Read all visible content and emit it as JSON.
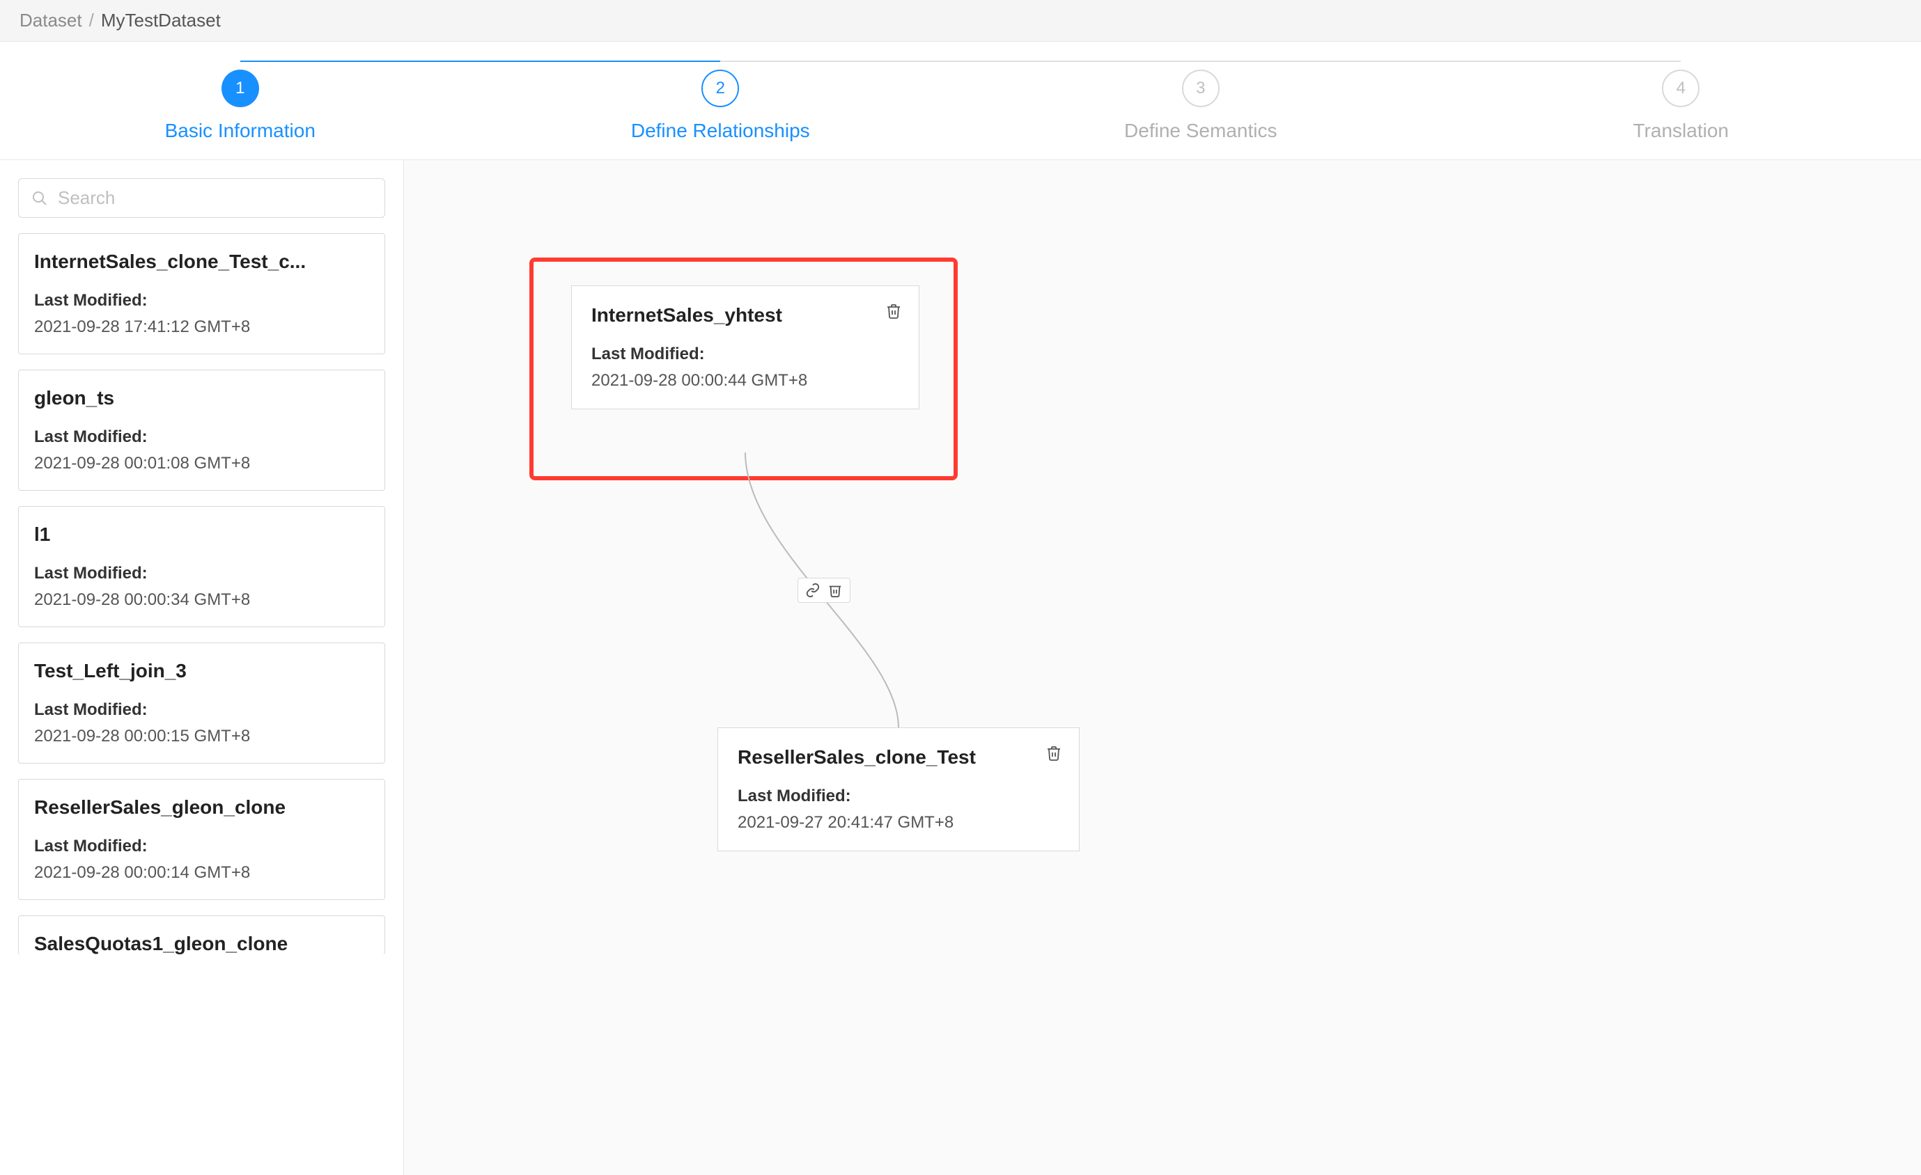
{
  "breadcrumb": {
    "root": "Dataset",
    "current": "MyTestDataset"
  },
  "stepper": {
    "steps": [
      {
        "num": "1",
        "label": "Basic Information",
        "state": "done"
      },
      {
        "num": "2",
        "label": "Define Relationships",
        "state": "current"
      },
      {
        "num": "3",
        "label": "Define Semantics",
        "state": "pending"
      },
      {
        "num": "4",
        "label": "Translation",
        "state": "pending"
      }
    ]
  },
  "sidebar": {
    "search_placeholder": "Search",
    "last_modified_label": "Last Modified:",
    "items": [
      {
        "title": "InternetSales_clone_Test_c...",
        "modified": "2021-09-28 17:41:12 GMT+8"
      },
      {
        "title": "gleon_ts",
        "modified": "2021-09-28 00:01:08 GMT+8"
      },
      {
        "title": "l1",
        "modified": "2021-09-28 00:00:34 GMT+8"
      },
      {
        "title": "Test_Left_join_3",
        "modified": "2021-09-28 00:00:15 GMT+8"
      },
      {
        "title": "ResellerSales_gleon_clone",
        "modified": "2021-09-28 00:00:14 GMT+8"
      },
      {
        "title": "SalesQuotas1_gleon_clone",
        "modified": ""
      }
    ]
  },
  "canvas": {
    "last_modified_label": "Last Modified:",
    "nodes": {
      "top": {
        "title": "InternetSales_yhtest",
        "modified": "2021-09-28 00:00:44 GMT+8"
      },
      "bottom": {
        "title": "ResellerSales_clone_Test",
        "modified": "2021-09-27 20:41:47 GMT+8"
      }
    }
  }
}
